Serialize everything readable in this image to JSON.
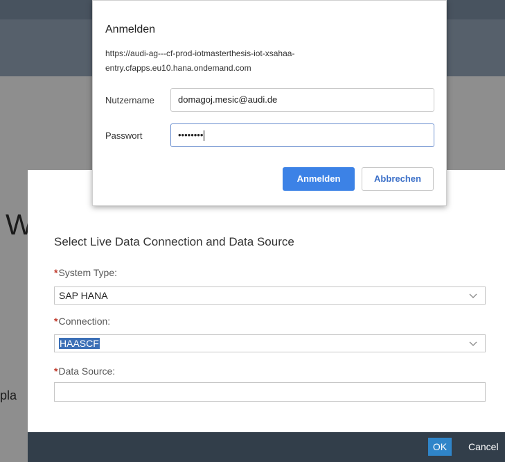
{
  "background": {
    "fragment_w": "W",
    "fragment_pla": "pla"
  },
  "dialog": {
    "title": "Select Live Data Connection and Data Source",
    "system_type": {
      "required_mark": "*",
      "label": "System Type:",
      "value": "SAP HANA"
    },
    "connection": {
      "required_mark": "*",
      "label": "Connection:",
      "value": "HAASCF"
    },
    "data_source": {
      "required_mark": "*",
      "label": "Data Source:",
      "value": ""
    },
    "footer": {
      "ok_label": "OK",
      "cancel_label": "Cancel"
    }
  },
  "login": {
    "title": "Anmelden",
    "url_line1": "https://audi-ag---cf-prod-iotmasterthesis-iot-xsahaa-",
    "url_line2": "entry.cfapps.eu10.hana.ondemand.com",
    "username_label": "Nutzername",
    "username_value": "domagoj.mesic@audi.de",
    "password_label": "Passwort",
    "password_value": "••••••••",
    "submit_label": "Anmelden",
    "cancel_label": "Abbrechen"
  },
  "colors": {
    "header": "#48535f",
    "footer": "#323e4a",
    "primary_button": "#3c82e6",
    "ok_button": "#2f85c9",
    "required": "#c0392b"
  },
  "icons": {
    "dropdown": "chevron-down-icon"
  }
}
